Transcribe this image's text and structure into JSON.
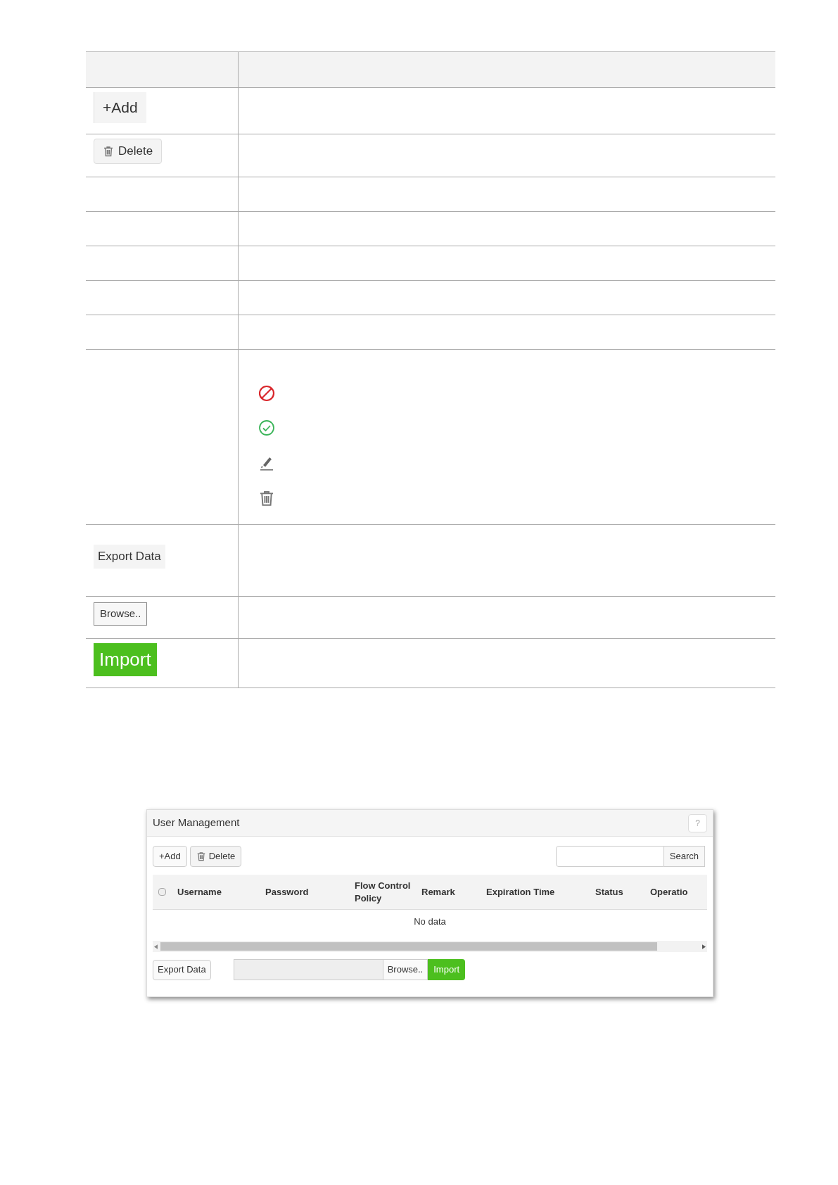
{
  "table": {
    "rows": [
      {
        "kind": "add",
        "label": "+Add"
      },
      {
        "kind": "delete",
        "label": "Delete"
      },
      {
        "kind": "empty"
      },
      {
        "kind": "empty"
      },
      {
        "kind": "empty"
      },
      {
        "kind": "empty"
      },
      {
        "kind": "empty"
      },
      {
        "kind": "icons"
      },
      {
        "kind": "export",
        "label": "Export Data"
      },
      {
        "kind": "browse",
        "label": "Browse.."
      },
      {
        "kind": "import",
        "label": "Import"
      }
    ]
  },
  "window": {
    "title": "User Management",
    "help": "?",
    "toolbar": {
      "add": "+Add",
      "delete": "Delete",
      "search_button": "Search"
    },
    "select_all": {
      "checked": false
    },
    "columns": [
      "Username",
      "Password",
      "Flow Control Policy",
      "Remark",
      "Expiration Time",
      "Status",
      "Operatio"
    ],
    "empty_text": "No data",
    "footer": {
      "export": "Export Data",
      "browse": "Browse..",
      "import": "Import"
    }
  }
}
